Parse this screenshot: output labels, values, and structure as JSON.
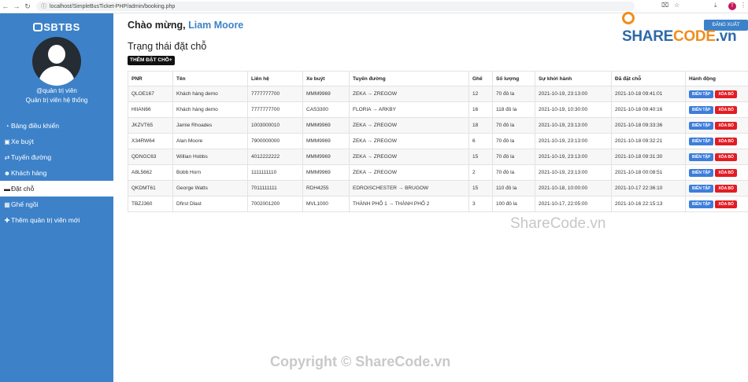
{
  "browser": {
    "url": "localhost/SimpleBusTicket-PHP/admin/booking.php",
    "profile_initial": "T"
  },
  "sidebar": {
    "brand": "SBTBS",
    "role_line1": "@quản trị viên",
    "role_line2": "Quản trị viên hệ thống",
    "items": [
      {
        "label": "Bảng điều khiển"
      },
      {
        "label": "Xe buýt"
      },
      {
        "label": "Tuyến đường"
      },
      {
        "label": "Khách hàng"
      },
      {
        "label": "Đặt chỗ"
      },
      {
        "label": "Ghế ngồi"
      },
      {
        "label": "Thêm quản trị viên mới"
      }
    ]
  },
  "header": {
    "welcome_prefix": "Chào mừng, ",
    "user_name": "Liam Moore",
    "logout_label": "ĐĂNG XUẤT"
  },
  "main": {
    "page_title": "Trạng thái đặt chỗ",
    "add_button": "THÊM ĐẶT CHỖ+"
  },
  "table": {
    "headers": [
      "PNR",
      "Tên",
      "Liên hệ",
      "Xe buýt",
      "Tuyến đường",
      "Ghế",
      "Số lượng",
      "Sự khởi hành",
      "Đã đặt chỗ",
      "Hành động"
    ],
    "edit_label": "BIÊN TẬP",
    "delete_label": "XÓA BỎ",
    "rows": [
      [
        "QLOE167",
        "Khách hàng demo",
        "7777777700",
        "MMM9969",
        "ZEKA → ZREGOW",
        "12",
        "70 đô la",
        "2021-10-19, 23:13:00",
        "2021-10-18 09:41:01"
      ],
      [
        "HIIAN66",
        "Khách hàng demo",
        "7777777700",
        "CAS3300",
        "FLORIA → ARKBY",
        "16",
        "118 đô la",
        "2021-10-19, 10:30:00",
        "2021-10-18 09:40:16"
      ],
      [
        "JKZVT65",
        "Jamie Rhoades",
        "1003000010",
        "MMM9969",
        "ZEKA → ZREGOW",
        "18",
        "70 đô la",
        "2021-10-19, 23:13:00",
        "2021-10-18 09:33:36"
      ],
      [
        "X34RW64",
        "Alan Moore",
        "7900000000",
        "MMM9969",
        "ZEKA → ZREGOW",
        "6",
        "70 đô la",
        "2021-10-19, 23:13:00",
        "2021-10-18 09:32:21"
      ],
      [
        "QDNGC63",
        "Willian Hobbs",
        "4012222222",
        "MMM9969",
        "ZEKA → ZREGOW",
        "15",
        "70 đô la",
        "2021-10-19, 23:13:00",
        "2021-10-18 09:31:30"
      ],
      [
        "A8L5662",
        "Bobb Horn",
        "1111111110",
        "MMM9969",
        "ZEKA → ZREGOW",
        "2",
        "70 đô la",
        "2021-10-19, 23:13:00",
        "2021-10-18 00:08:51"
      ],
      [
        "QKDMT61",
        "George Watts",
        "7011111111",
        "RDH4255",
        "EDROISCHESTER → BRUGOW",
        "15",
        "110 đô la",
        "2021-10-18, 10:00:00",
        "2021-10-17 22:36:10"
      ],
      [
        "TBZJ360",
        "Dfirst Dlast",
        "7002001200",
        "MVL1000",
        "THÀNH PHỐ 1 → THÀNH PHỐ 2",
        "3",
        "100 đô la",
        "2021-10-17, 22:05:00",
        "2021-10-16 22:15:13"
      ]
    ]
  },
  "watermarks": {
    "logo_main": "SHARE",
    "logo_accent": "CODE",
    "logo_suffix": ".vn",
    "mid": "ShareCode.vn",
    "bottom": "Copyright © ShareCode.vn"
  }
}
